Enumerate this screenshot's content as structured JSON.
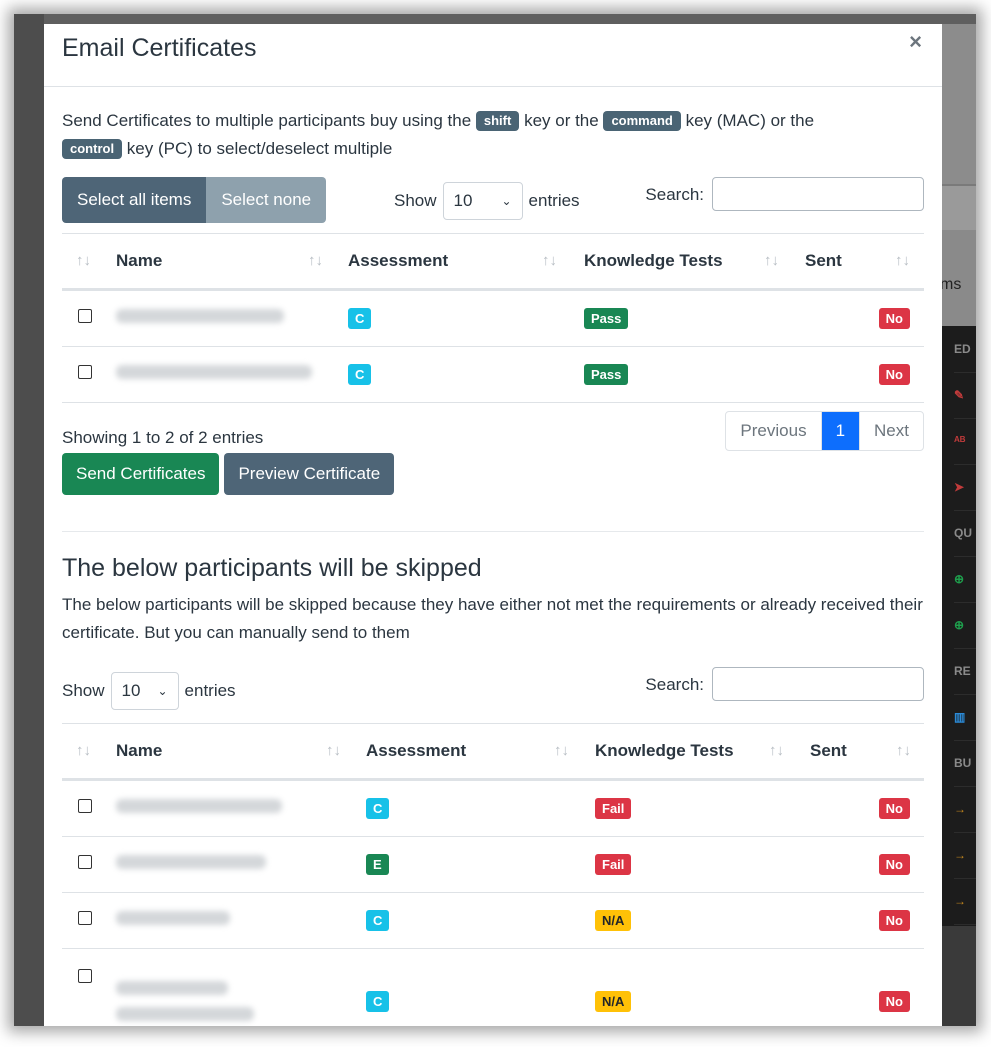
{
  "modal": {
    "title": "Email Certificates",
    "close_glyph": "×",
    "intro": {
      "part1": "Send Certificates to multiple participants buy using the ",
      "key_shift": "shift",
      "part2": " key or the ",
      "key_command": "command",
      "part3": " key (MAC) or the ",
      "key_control": "control",
      "part4": " key (PC) to select/deselect multiple"
    }
  },
  "table1": {
    "select_all_label": "Select all items",
    "select_none_label": "Select none",
    "show_label": "Show",
    "entries_value": "10",
    "entries_label": "entries",
    "search_label": "Search:",
    "columns": [
      "Name",
      "Assessment",
      "Knowledge Tests",
      "Sent"
    ],
    "rows": [
      {
        "assessment": "C",
        "knowledge": "Pass",
        "sent": "No"
      },
      {
        "assessment": "C",
        "knowledge": "Pass",
        "sent": "No"
      }
    ],
    "info": "Showing 1 to 2 of 2 entries",
    "pager": {
      "previous": "Previous",
      "page": "1",
      "next": "Next"
    },
    "send_label": "Send Certificates",
    "preview_label": "Preview Certificate"
  },
  "skipped": {
    "heading": "The below participants will be skipped",
    "description": "The below participants will be skipped because they have either not met the requirements or already received their certificate. But you can manually send to them"
  },
  "table2": {
    "show_label": "Show",
    "entries_value": "10",
    "entries_label": "entries",
    "search_label": "Search:",
    "columns": [
      "Name",
      "Assessment",
      "Knowledge Tests",
      "Sent"
    ],
    "rows": [
      {
        "assessment": "C",
        "knowledge": "Fail",
        "sent": "No"
      },
      {
        "assessment": "E",
        "knowledge": "Fail",
        "sent": "No"
      },
      {
        "assessment": "C",
        "knowledge": "N/A",
        "sent": "No"
      },
      {
        "assessment": "C",
        "knowledge": "N/A",
        "sent": "No"
      }
    ]
  },
  "background": {
    "partial_text": "ms",
    "sidebar_labels": [
      "ED",
      "QU",
      "RE",
      "BU"
    ]
  },
  "colors": {
    "success": "#198754",
    "danger": "#dc3545",
    "info": "#17c1e8",
    "warning": "#ffc107",
    "primary": "#0d6efd",
    "slate": "#4e6577"
  }
}
